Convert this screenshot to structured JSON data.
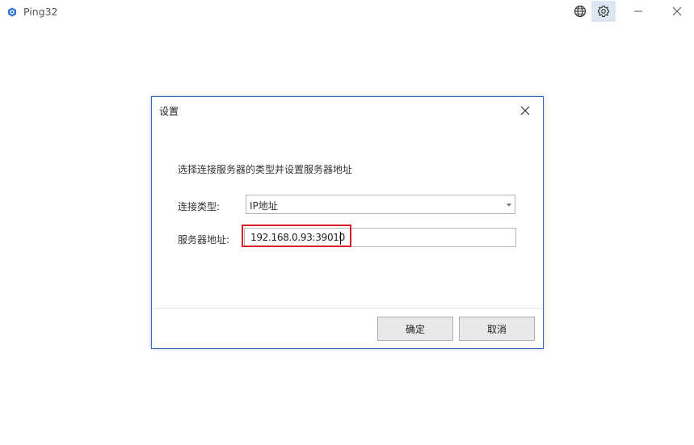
{
  "app": {
    "title": "Ping32",
    "icons": {
      "app": "app-logo-icon",
      "language": "globe-icon",
      "settings": "gear-icon",
      "minimize": "minimize-icon",
      "close": "close-icon"
    },
    "accent_color": "#2b6cb8",
    "highlight_color": "#d9202a"
  },
  "dialog": {
    "title": "设置",
    "intro": "选择连接服务器的类型并设置服务器地址",
    "connection_type": {
      "label": "连接类型:",
      "value": "IP地址"
    },
    "server_address": {
      "label": "服务器地址:",
      "value": "192.168.0.93:39010"
    },
    "ok_label": "确定",
    "cancel_label": "取消"
  }
}
